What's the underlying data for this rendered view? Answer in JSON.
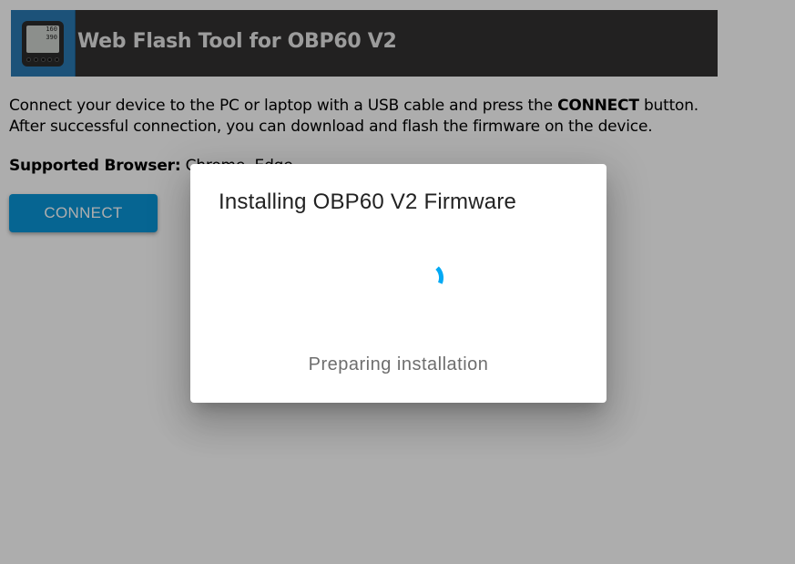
{
  "header": {
    "title": "Web Flash Tool for OBP60 V2",
    "logo_screen_top": "160",
    "logo_screen_mid": "390"
  },
  "intro": {
    "line1_before": "Connect your device to the PC or laptop with a USB cable and press the ",
    "line1_bold": "CONNECT",
    "line1_after": " button.",
    "line2": "After successful connection, you can download and flash the firmware on the device."
  },
  "browser": {
    "label": "Supported Browser:",
    "value": " Chrome, Edge"
  },
  "connect_button": {
    "label": "CONNECT"
  },
  "dialog": {
    "title": "Installing OBP60 V2 Firmware",
    "status": "Preparing installation"
  },
  "colors": {
    "accent": "#0a95d8",
    "header_bg": "#333132",
    "spinner": "#03a9f4"
  },
  "icons": {
    "spinner": "progress-spinner-icon",
    "logo": "obp60-device-logo"
  }
}
